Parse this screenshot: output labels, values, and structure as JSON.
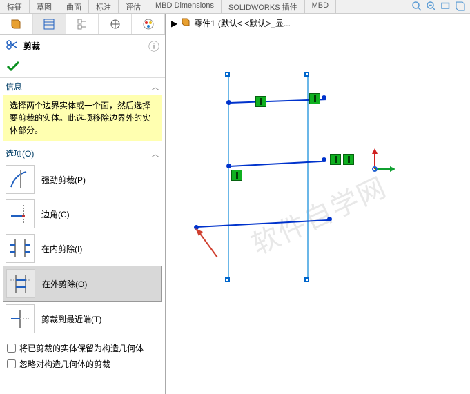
{
  "topTabs": [
    "特征",
    "草图",
    "曲面",
    "标注",
    "评估",
    "MBD Dimensions",
    "SOLIDWORKS 插件",
    "MBD"
  ],
  "breadcrumb": {
    "part": "零件1",
    "config": "(默认< <默认>_显..."
  },
  "panel": {
    "title": "剪裁",
    "info_header": "信息",
    "info_text": "选择两个边界实体或一个面，然后选择要剪裁的实体。此选项移除边界外的实体部分。",
    "options_header": "选项(O)",
    "options": [
      {
        "label": "强劲剪裁(P)"
      },
      {
        "label": "边角(C)"
      },
      {
        "label": "在内剪除(I)"
      },
      {
        "label": "在外剪除(O)"
      },
      {
        "label": "剪裁到最近端(T)"
      }
    ],
    "checks": [
      "将已剪裁的实体保留为构造几何体",
      "忽略对构造几何体的剪裁"
    ]
  },
  "watermark": "软件自学网"
}
